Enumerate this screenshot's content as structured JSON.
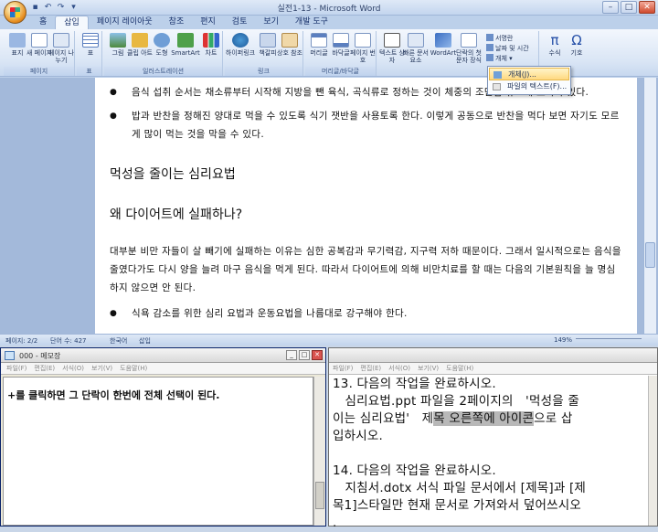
{
  "word": {
    "title": "실전1-13 - Microsoft Word",
    "tabs": [
      "홈",
      "삽입",
      "페이지 레이아웃",
      "참조",
      "편지",
      "검토",
      "보기",
      "개발 도구"
    ],
    "active_tab": "삽입",
    "ribbon": {
      "pages": {
        "label": "페이지",
        "buttons": [
          "표지",
          "새 페이지",
          "페이지 나누기"
        ]
      },
      "table": {
        "label": "표",
        "buttons": [
          "표"
        ]
      },
      "illustrations": {
        "label": "일러스트레이션",
        "buttons": [
          "그림",
          "클립 아트",
          "도형",
          "SmartArt",
          "차트"
        ]
      },
      "links": {
        "label": "링크",
        "buttons": [
          "하이퍼링크",
          "책갈피",
          "상호 참조"
        ]
      },
      "header_footer": {
        "label": "머리글/바닥글",
        "buttons": [
          "머리글",
          "바닥글",
          "페이지 번호"
        ]
      },
      "text": {
        "label": "텍스트",
        "buttons": [
          "텍스트 상자",
          "빠른 문서 요소",
          "WordArt",
          "단락의 첫 문자 장식"
        ],
        "small": [
          "서명란",
          "날짜 및 시간",
          "개체"
        ]
      },
      "symbols": {
        "buttons": [
          "수식",
          "기호"
        ]
      }
    },
    "object_menu": {
      "items": [
        "개체(J)...",
        "파일의 텍스트(F)..."
      ]
    },
    "document": {
      "bullet1": "음식 섭취 순서는 채소류부터 시작해 지방을 뺀 육식, 곡식류로 정하는 것이 체중의 조만감 유도에 효과가 있다.",
      "bullet2": "밥과 반찬을 정해진 양대로 먹을 수 있도록 식기 잿반을 사용토록 한다. 이렇게 공동으로 반찬을 먹다 보면 자기도 모르게 많이 먹는 것을 막을 수 있다.",
      "heading1": "먹성을 줄이는 심리요법",
      "heading2": "왜 다이어트에 실패하나?",
      "paragraph": "대부분 비만 자들이 살 빼기에 실패하는 이유는 심한 공복감과 무기력감, 지구력 저하 때문이다. 그래서 일시적으로는 음식을 줄였다가도 다시 양을 늘려 마구 음식을 먹게 된다. 따라서 다이어트에 의해 비만치료를 할 때는 다음의 기본원칙을 늘 명심하지 않으면 안 된다.",
      "bullet3": "식욕 감소를 위한 심리 요법과 운동요법을 나름대로 강구해야 한다."
    },
    "status": {
      "page": "페이지: 2/2",
      "words": "단어 수: 427",
      "lang": "한국어",
      "insert": "삽입",
      "zoom": "149%"
    }
  },
  "notepad": {
    "title": "000 - 메모장",
    "menu": [
      "파일(F)",
      "편집(E)",
      "서식(O)",
      "보기(V)",
      "도움말(H)"
    ],
    "content": "+를 클릭하면 그 단락이 한번에 전체 선택이 된다."
  },
  "viewer": {
    "menu": [
      "파일(F)",
      "편집(E)",
      "서식(O)",
      "보기(V)",
      "도움말(H)"
    ],
    "q13_title": "13. 다음의 작업을 완료하시오.",
    "q13_line1": "   심리요법.ppt 파일을 2페이지의   '먹성을 줄",
    "q13_line2a": "이는 심리요법'   제",
    "q13_line2b": "목 오른쪽에 아이콘",
    "q13_line2c": "으로 삽",
    "q13_line3": "입하시오.",
    "q14_title": "14. 다음의 작업을 완료하시오.",
    "q14_line1": "   지침서.dotx 서식 파일 문서에서 [제목]과 [제",
    "q14_line2": "목1]스타일만 현재 문서로 가져와서 덮어쓰시오",
    "q14_line3": "."
  }
}
